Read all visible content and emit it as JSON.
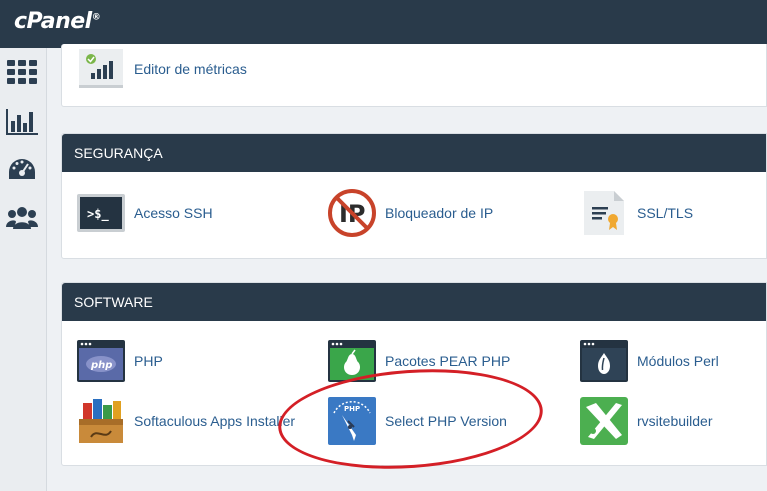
{
  "header": {
    "logo_text": "cPanel",
    "logo_mark": "®"
  },
  "sidebar": {
    "items": [
      {
        "icon": "grid-icon"
      },
      {
        "icon": "stats-icon"
      },
      {
        "icon": "dashboard-gauge-icon"
      },
      {
        "icon": "users-icon"
      }
    ]
  },
  "sections": {
    "metrics": {
      "items": [
        {
          "label": "Editor de métricas",
          "icon": "metrics-editor-icon"
        }
      ]
    },
    "security": {
      "title": "SEGURANÇA",
      "items": [
        {
          "label": "Acesso SSH",
          "icon": "terminal-icon"
        },
        {
          "label": "Bloqueador de IP",
          "icon": "ip-blocker-icon"
        },
        {
          "label": "SSL/TLS",
          "icon": "certificate-icon"
        }
      ]
    },
    "software": {
      "title": "SOFTWARE",
      "items": [
        {
          "label": "PHP",
          "icon": "php-icon"
        },
        {
          "label": "Pacotes PEAR PHP",
          "icon": "pear-icon"
        },
        {
          "label": "Módulos Perl",
          "icon": "perl-icon"
        },
        {
          "label": "Softaculous Apps Installer",
          "icon": "softaculous-icon"
        },
        {
          "label": "Select PHP Version",
          "icon": "php-version-icon"
        },
        {
          "label": "rvsitebuilder",
          "icon": "rvsitebuilder-icon"
        }
      ]
    }
  },
  "annotation": {
    "color": "#d41f26",
    "target": "Select PHP Version"
  },
  "colors": {
    "topbar": "#293a4a",
    "link": "#2a5d8f",
    "background": "#eef1f4"
  }
}
